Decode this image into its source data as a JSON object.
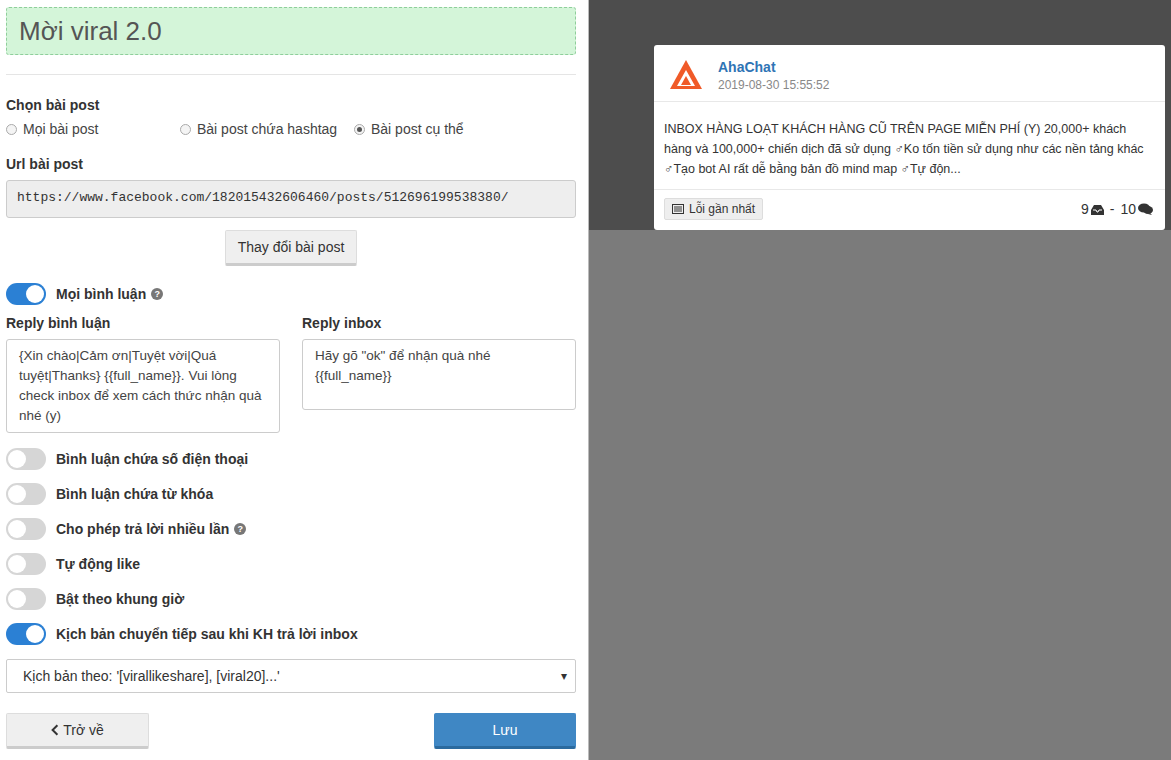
{
  "panel": {
    "title": "Mời viral 2.0"
  },
  "post_choice": {
    "label": "Chọn bài post",
    "options": [
      {
        "label": "Mọi bài post",
        "selected": false
      },
      {
        "label": "Bài post chứa hashtag",
        "selected": false
      },
      {
        "label": "Bài post cụ thể",
        "selected": true
      }
    ]
  },
  "post_url": {
    "label": "Url bài post",
    "value": "https://www.facebook.com/182015432606460/posts/512696199538380/"
  },
  "change_post_button": "Thay đổi bài post",
  "all_comments": {
    "label": "Mọi bình luận",
    "on": true,
    "has_help": true
  },
  "reply_comment": {
    "label": "Reply bình luận",
    "value": "{Xin chào|Cảm ơn|Tuyệt vời|Quá tuyệt|Thanks} {{full_name}}. Vui lòng check inbox để xem cách thức nhận quà nhé (y)"
  },
  "reply_inbox": {
    "label": "Reply inbox",
    "value": "Hãy gõ \"ok\" để nhận quà nhé {{full_name}}"
  },
  "toggles": [
    {
      "label": "Bình luận chứa số điện thoại",
      "on": false,
      "has_help": false
    },
    {
      "label": "Bình luận chứa từ khóa",
      "on": false,
      "has_help": false
    },
    {
      "label": "Cho phép trả lời nhiều lần",
      "on": false,
      "has_help": true
    },
    {
      "label": "Tự động like",
      "on": false,
      "has_help": false
    },
    {
      "label": "Bật theo khung giờ",
      "on": false,
      "has_help": false
    },
    {
      "label": "Kịch bản chuyển tiếp sau khi KH trả lời inbox",
      "on": true,
      "has_help": false
    }
  ],
  "script_select": {
    "value": "Kịch bản theo: '[virallikeshare], [viral20]...'",
    "arrow": "▾"
  },
  "buttons": {
    "back": "Trở về",
    "save": "Lưu"
  },
  "preview": {
    "page_name": "AhaChat",
    "time": "2019-08-30 15:55:52",
    "text": "INBOX HÀNG LOẠT KHÁCH HÀNG CŨ TRÊN PAGE MIỄN PHÍ (Y) 20,000+ khách hàng và 100,000+ chiến dịch đã sử dụng ♂Ko tốn tiền sử dụng như các nền tảng khác ♂Tạo bot AI rất dễ bằng bản đồ mind map ♂Tự độn...",
    "recent_errors": "Lỗi gần nhất",
    "inbox_count": "9",
    "separator": "-",
    "comment_count": "10"
  }
}
